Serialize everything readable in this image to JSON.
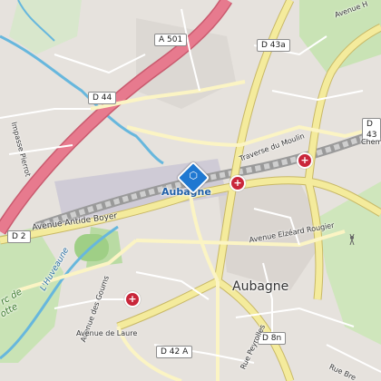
{
  "road_shields": {
    "a501": "A 501",
    "d43a": "D 43a",
    "d44": "D 44",
    "d43_right": "D 43",
    "d2": "D 2",
    "d42a": "D 42 A",
    "d8n": "D 8n"
  },
  "street_labels": {
    "avenue_hippolyte": "Avenue H",
    "chemin_right": "Chem",
    "traverse_moulin": "Traverse du Moulin",
    "avenue_antide_boyer": "Avenue Antide Boyer",
    "avenue_elzeard_rougier": "Avenue Elzéard Rougier",
    "impasse_pierrot": "Impasse Pierrot",
    "huveaune": "L'Huveaune",
    "avenue_goums": "Avenue des Goums",
    "avenue_laure": "Avenue de Laure",
    "rue_peyrolles": "Rue Peyrolles",
    "rue_bre": "Rue Bre",
    "parc_de": "rc de",
    "otte": "otte"
  },
  "place_labels": {
    "aubagne_station": "Aubagne",
    "aubagne_town": "Aubagne"
  },
  "colors": {
    "motorway": "#e77a8e",
    "primary": "#f4eb9c",
    "secondary": "#fbf4c4",
    "river": "#67b7dd",
    "park": "#c9e3b5",
    "rail": "#8e8e8e",
    "poi": "#c9263a",
    "station": "#1f78d1"
  },
  "icons": [
    "pharmacy-icon",
    "train-station-icon",
    "transmitter-icon"
  ]
}
